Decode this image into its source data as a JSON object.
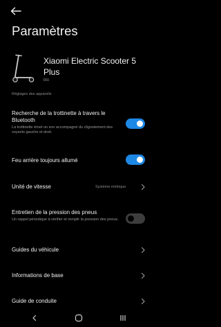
{
  "header": {
    "back_icon": "arrow-left-icon",
    "title": "Paramètres"
  },
  "device": {
    "image": "electric-scooter-image",
    "name": "Xiaomi Electric Scooter 5 Plus",
    "id_text": "blo"
  },
  "section": {
    "label": "Réglages des appareils"
  },
  "settings": {
    "search_bluetooth": {
      "title": "Recherche de la trottinette à travers le Bluetooth",
      "subtitle": "La trottinette émet un son accompagné du clignotement des voyants gauche et droit.",
      "enabled": true
    },
    "rear_light": {
      "title": "Feu arrière toujours allumé",
      "enabled": true
    },
    "speed_unit": {
      "title": "Unité de vitesse",
      "value": "Système métrique"
    },
    "tire_pressure": {
      "title": "Entretien de la pression des pneus",
      "subtitle": "Un rappel périodique à vérifier et remplir la pression des pneus.",
      "enabled": false
    },
    "vehicle_guides": {
      "title": "Guides du véhicule"
    },
    "basic_info": {
      "title": "Informations de base"
    },
    "riding_guide": {
      "title": "Guide de conduite"
    }
  },
  "colors": {
    "accent": "#1e88e5",
    "background": "#000000",
    "secondary_text": "#8a8a8a"
  },
  "nav": {
    "back_icon": "nav-back-icon",
    "home_icon": "nav-home-icon",
    "recents_icon": "nav-recents-icon"
  }
}
